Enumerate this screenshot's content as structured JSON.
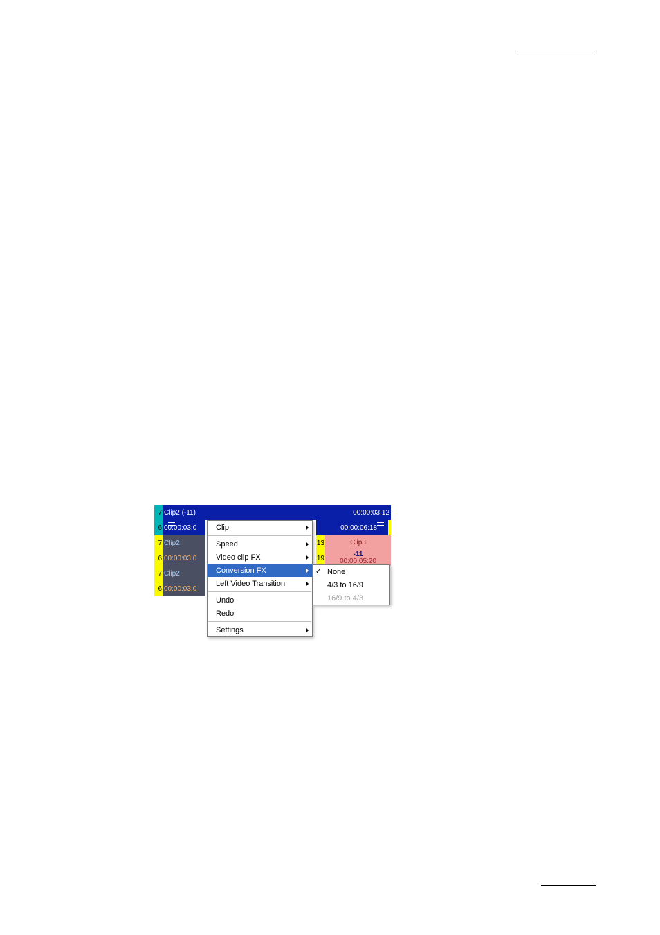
{
  "track1": {
    "numTop": "7",
    "numBot": "6",
    "clipLabel": "Clip2 (-11)",
    "timeLeft": "00:00:03:0",
    "timeRight": "00:00:03:12",
    "timeRight2": "00:00:06:18"
  },
  "track2": {
    "numTop": "7",
    "numBot": "6",
    "clipLabel": "Clip2",
    "timeLeft": "00:00:03:0",
    "gapTop": "13",
    "gapBot": "19",
    "right": {
      "label": "Clip3",
      "badge": "-11",
      "time": "00:00:05:20"
    }
  },
  "track3": {
    "numTop": "7",
    "numBot": "6",
    "clipLabel": "Clip2",
    "timeLeft": "00:00:03:0"
  },
  "menu": {
    "clip": "Clip",
    "speed": "Speed",
    "videoClipFX": "Video clip FX",
    "conversionFX": "Conversion FX",
    "leftVideoTransition": "Left Video Transition",
    "undo": "Undo",
    "redo": "Redo",
    "settings": "Settings"
  },
  "submenu": {
    "none": "None",
    "a": "4/3 to 16/9",
    "b": "16/9 to 4/3"
  },
  "colors": {
    "blueDark": "#0a1fa8",
    "blueMid": "#2b5fbf",
    "yellow": "#f9f900",
    "teal": "#00b5b5",
    "pink": "#f2a0a0",
    "pinkDark": "#d66868",
    "trackDark": "#4a5062"
  }
}
